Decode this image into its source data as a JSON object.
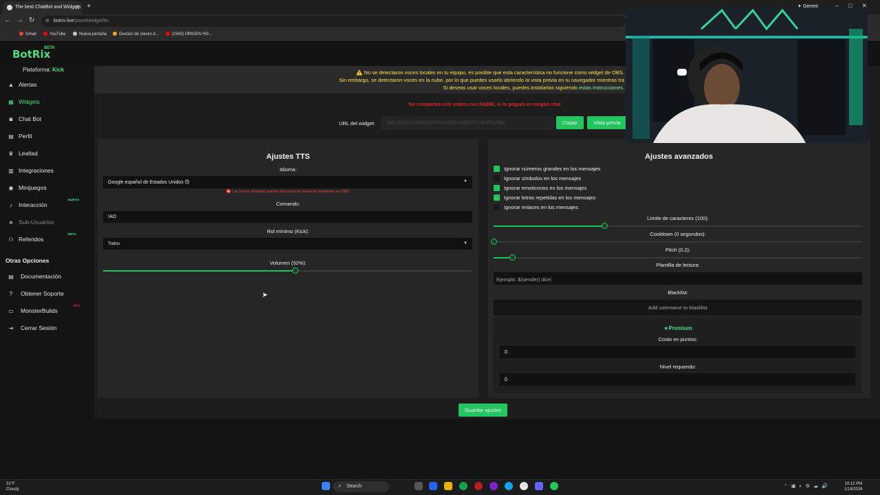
{
  "browser": {
    "tab_title": "The best ChatBot and Widgets",
    "url_host": "botrix.live",
    "url_path": "/panel/widget/tts",
    "profile_label": "Gemini",
    "bookmarks": [
      {
        "label": "Gmail",
        "color": "#ea4335"
      },
      {
        "label": "YouTube",
        "color": "#ff0000"
      },
      {
        "label": "Nueva pestaña",
        "color": "#cccccc"
      },
      {
        "label": "Gestión de claves d...",
        "color": "#f5a623"
      },
      {
        "label": "(2343) ORIGEN HO...",
        "color": "#ff0000"
      }
    ]
  },
  "app": {
    "logo": "BotRix",
    "logo_badge": "BETA",
    "platform_label": "Plataforma:",
    "platform_value": "Kick"
  },
  "sidebar": {
    "items": [
      {
        "label": "Alertas",
        "icon": "warning-icon"
      },
      {
        "label": "Widgets",
        "icon": "grid-icon",
        "active": true
      },
      {
        "label": "Chat Bot",
        "icon": "robot-icon"
      },
      {
        "label": "Perfil",
        "icon": "id-card-icon"
      },
      {
        "label": "Lealtad",
        "icon": "trophy-icon"
      },
      {
        "label": "Integraciones",
        "icon": "plug-icon"
      },
      {
        "label": "Minijuegos",
        "icon": "gamepad-icon"
      },
      {
        "label": "Interacción",
        "icon": "music-icon",
        "badge": "NUEVO"
      },
      {
        "label": "Sub-Usuarios",
        "icon": "users-icon",
        "dim": true
      },
      {
        "label": "Referidos",
        "icon": "referral-icon",
        "badge": "BETA"
      }
    ],
    "other_title": "Otras Opciones",
    "other_items": [
      {
        "label": "Documentación",
        "icon": "book-icon"
      },
      {
        "label": "Obtener Soporte",
        "icon": "help-icon"
      },
      {
        "label": "MonsterBuilds",
        "icon": "laptop-icon",
        "badge": "PRO"
      },
      {
        "label": "Cerrar Sesión",
        "icon": "logout-icon"
      }
    ]
  },
  "notice": {
    "line1": "No se detectaron voces locales en tu equipo, es posible que esta característica no funcione como widget de OBS.",
    "line2": "Sin embargo, se detectaron voces en la nube, por lo que puedes usarlo abriendo la vista previa en tu navegador mientras tra",
    "line3_prefix": "Si deseas usar voces locales, puedes instalarlas siguiendo",
    "line3_link": "estas instrucciones",
    "line3_suffix": ".",
    "share_warning": "No compartas este enlace con NADIE, ni lo pegues en ningún chat"
  },
  "widget_url": {
    "label": "URL del widget:",
    "value": "https://botrix.live/widgets/tts?bid=KD3h-9kdQmFhx7bL8Rvs0Nga",
    "copy_label": "Copiar",
    "preview_label": "Vista previa"
  },
  "tts": {
    "title": "Ajustes TTS",
    "language_label": "Idioma:",
    "language_value": "Google español de Estados Unidos 😊",
    "voice_warning": "Las voces amarillas pueden funcionar de forma inconsistente en OBS",
    "command_label": "Comando:",
    "command_value": "!AO",
    "role_label": "Rol mínimo (Kick):",
    "role_value": "Todos",
    "volume_label": "Volumen (52%):",
    "volume": 0.52
  },
  "advanced": {
    "title": "Ajustes avanzados",
    "checks": [
      {
        "label": "Ignorar números grandes en los mensajes",
        "checked": true
      },
      {
        "label": "Ignorar símbolos en los mensajes",
        "checked": false
      },
      {
        "label": "Ignorar emoticonos en los mensajes",
        "checked": true
      },
      {
        "label": "Ignorar letras repetidas en los mensajes",
        "checked": true
      },
      {
        "label": "Ignorar enlaces en los mensajes",
        "checked": false
      }
    ],
    "char_limit_label": "Límite de caracteres (100):",
    "char_limit": 0.3,
    "cooldown_label": "Cooldown (0 segundos):",
    "cooldown": 0,
    "pitch_label": "Pitch (0.2):",
    "pitch": 0.05,
    "template_label": "Plantilla de lectura:",
    "template_placeholder": "Ejemplo: $(sender) dice:",
    "blacklist_label": "Blacklist:",
    "blacklist_placeholder": "Add username to blacklist",
    "premium_label": "Premium",
    "cost_label": "Costo en puntos:",
    "cost_value": "0",
    "level_label": "Nivel requerido:",
    "level_value": "0"
  },
  "save_label": "Guardar ajustes",
  "taskbar": {
    "weather_temp": "31°F",
    "weather_desc": "Cloudy",
    "search_label": "Search",
    "time": "10:12 PM",
    "date": "1/18/2026"
  }
}
